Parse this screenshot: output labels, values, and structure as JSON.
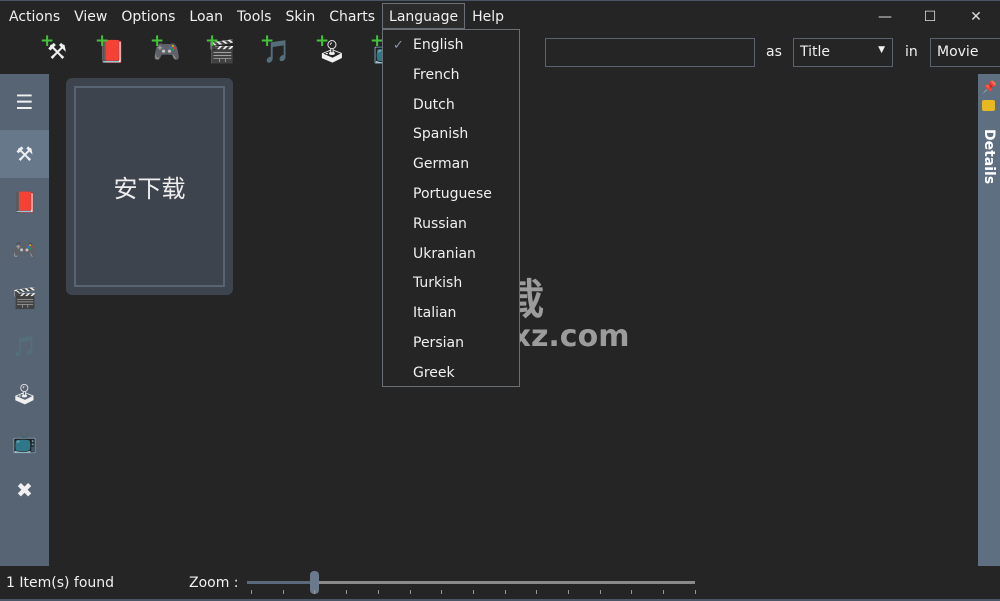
{
  "menu": [
    "Actions",
    "View",
    "Options",
    "Loan",
    "Tools",
    "Skin",
    "Charts",
    "Language",
    "Help"
  ],
  "window_controls": {
    "minimize": "—",
    "maximize": "☐",
    "close": "✕"
  },
  "toolbar": [
    {
      "icon": "add-tools-icon",
      "glyph": "⚒"
    },
    {
      "icon": "add-book-icon",
      "glyph": "📕"
    },
    {
      "icon": "add-game-icon",
      "glyph": "🎮"
    },
    {
      "icon": "add-movie-icon",
      "glyph": "🎬"
    },
    {
      "icon": "add-music-icon",
      "glyph": "🎵"
    },
    {
      "icon": "add-console-icon",
      "glyph": "🕹"
    },
    {
      "icon": "add-tv-icon",
      "glyph": "📺"
    }
  ],
  "search": {
    "value": "",
    "as_label": "as",
    "as_value": "Title",
    "in_label": "in",
    "in_value": "Movie"
  },
  "sidebar": [
    {
      "icon": "menu-icon",
      "glyph": "☰"
    },
    {
      "icon": "tools-icon",
      "glyph": "⚒"
    },
    {
      "icon": "book-icon",
      "glyph": "📕"
    },
    {
      "icon": "game-icon",
      "glyph": "🎮"
    },
    {
      "icon": "movie-icon",
      "glyph": "🎬"
    },
    {
      "icon": "music-icon",
      "glyph": "🎵"
    },
    {
      "icon": "console-icon",
      "glyph": "🕹"
    },
    {
      "icon": "tv-icon",
      "glyph": "📺"
    },
    {
      "icon": "x-folder-icon",
      "glyph": "✖"
    }
  ],
  "card": {
    "title": "安下载"
  },
  "language_menu": {
    "selected": "English",
    "items": [
      "English",
      "French",
      "Dutch",
      "Spanish",
      "German",
      "Portuguese",
      "Russian",
      "Ukranian",
      "Turkish",
      "Italian",
      "Persian",
      "Greek"
    ]
  },
  "details_panel": {
    "label": "Details"
  },
  "watermark": {
    "text": "安下载",
    "url": "anxz.com"
  },
  "status": {
    "items_found": "1 Item(s) found",
    "zoom_label": "Zoom :",
    "zoom_percent": 15
  },
  "colors": {
    "sidebar": "#566474",
    "accent": "#66788a",
    "background": "#252525"
  }
}
